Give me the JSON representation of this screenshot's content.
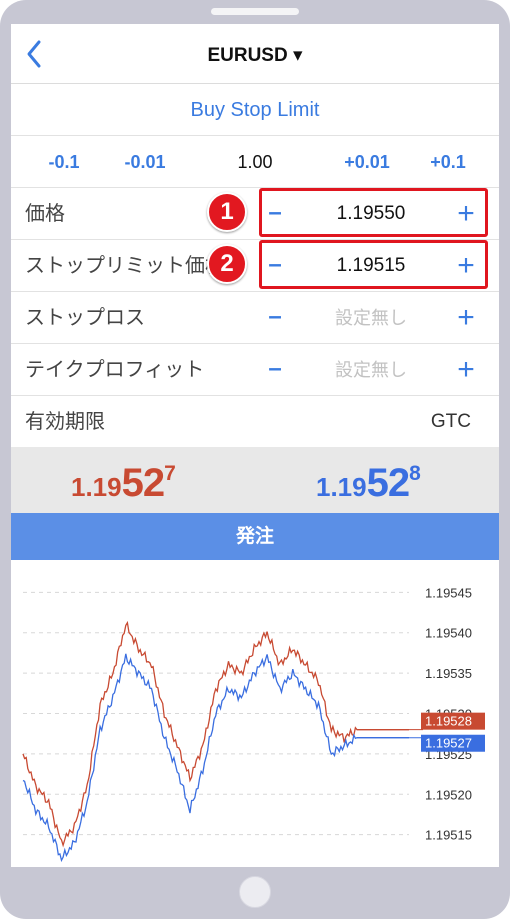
{
  "header": {
    "title": "EURUSD ▾"
  },
  "order_type": "Buy Stop Limit",
  "steps": [
    {
      "label": "-0.1"
    },
    {
      "label": "-0.01"
    },
    {
      "label": "1.00"
    },
    {
      "label": "+0.01"
    },
    {
      "label": "+0.1"
    }
  ],
  "form": {
    "price": {
      "label": "価格",
      "value": "1.19550",
      "badge": "1"
    },
    "stop_limit_price": {
      "label": "ストップリミット価格",
      "value": "1.19515",
      "badge": "2"
    },
    "stop_loss": {
      "label": "ストップロス",
      "value": "設定無し"
    },
    "take_profit": {
      "label": "テイクプロフィット",
      "value": "設定無し"
    },
    "expiry": {
      "label": "有効期限",
      "value": "GTC"
    },
    "minus": "–",
    "plus": "+"
  },
  "quotes": {
    "bid": {
      "prefix": "1.19",
      "big": "52",
      "sup": "7"
    },
    "ask": {
      "prefix": "1.19",
      "big": "52",
      "sup": "8"
    }
  },
  "order_button": "発注",
  "colors": {
    "accent": "#3a7be0",
    "bid": "#c84a32",
    "ask": "#3a6ee0",
    "button": "#5b8fe6",
    "highlight": "#e0161f"
  },
  "chart_data": {
    "type": "line",
    "ylim": [
      1.19511,
      1.19549
    ],
    "yticks": [
      "1.19545",
      "1.19540",
      "1.19535",
      "1.19530",
      "1.19525",
      "1.19520",
      "1.19515"
    ],
    "grid": true,
    "series": [
      {
        "color": "#c84a32",
        "values": [
          1.19525,
          1.19521,
          1.19519,
          1.19514,
          1.19516,
          1.19521,
          1.19531,
          1.19535,
          1.19541,
          1.19538,
          1.19536,
          1.1953,
          1.19526,
          1.19522,
          1.19526,
          1.19533,
          1.19536,
          1.19535,
          1.19538,
          1.1954,
          1.19536,
          1.19538,
          1.19536,
          1.19534,
          1.19528,
          1.19527,
          1.19528
        ]
      },
      {
        "color": "#3a6ee0",
        "values": [
          1.19522,
          1.19518,
          1.19516,
          1.19512,
          1.19514,
          1.19519,
          1.19528,
          1.19532,
          1.19537,
          1.19535,
          1.19533,
          1.19527,
          1.19523,
          1.19518,
          1.19523,
          1.1953,
          1.19533,
          1.19532,
          1.19535,
          1.19537,
          1.19533,
          1.19535,
          1.19533,
          1.19531,
          1.19525,
          1.19526,
          1.19527
        ]
      }
    ],
    "markers": [
      {
        "label": "1.19528",
        "value": 1.19528,
        "color": "#c84a32"
      },
      {
        "label": "1.19527",
        "value": 1.19527,
        "color": "#3a6ee0"
      }
    ]
  }
}
